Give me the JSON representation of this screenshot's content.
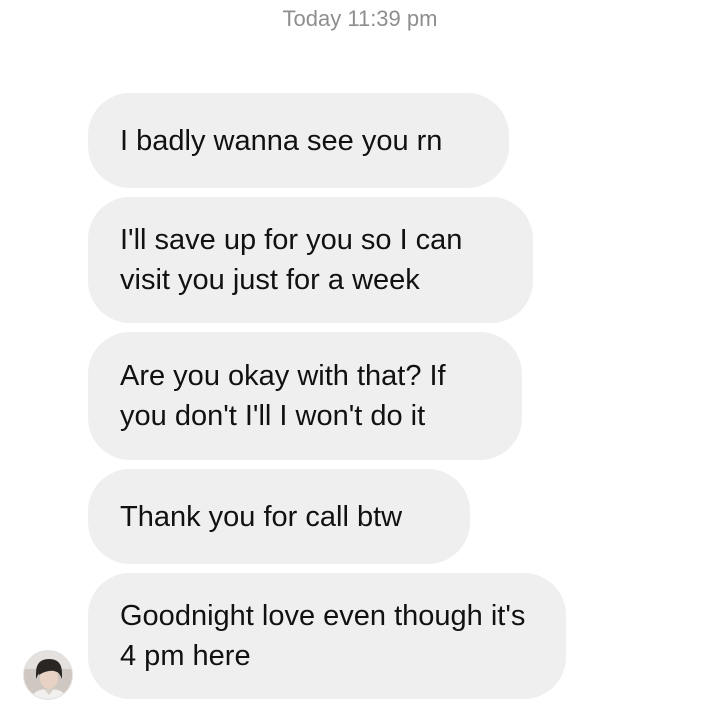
{
  "thread": {
    "timestamp": "Today 11:39 pm",
    "messages": [
      "I badly wanna see you rn",
      "I'll save up for you so I can visit you just for a week",
      "Are you okay with that? If you don't I'll I won't do it",
      "Thank you for call btw",
      "Goodnight love even though it's 4 pm here"
    ]
  },
  "colors": {
    "bubble_bg": "#efefef",
    "text": "#111111",
    "timestamp": "#8e8e8e"
  },
  "icons": {
    "avatar": "sender-avatar-photo"
  }
}
